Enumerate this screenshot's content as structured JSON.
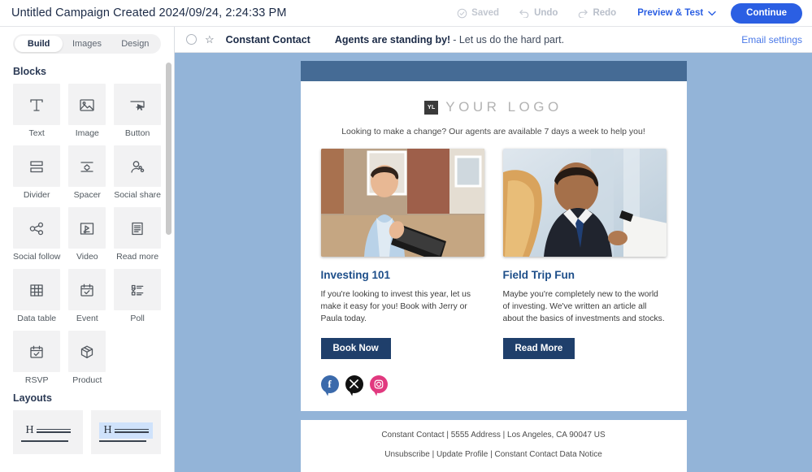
{
  "topbar": {
    "campaign_title": "Untitled Campaign Created 2024/09/24, 2:24:33 PM",
    "saved_label": "Saved",
    "undo_label": "Undo",
    "redo_label": "Redo",
    "preview_test_label": "Preview & Test",
    "continue_label": "Continue",
    "accent_color": "#2b5fe3"
  },
  "sidebar": {
    "tabs": [
      {
        "label": "Build",
        "active": true
      },
      {
        "label": "Images",
        "active": false
      },
      {
        "label": "Design",
        "active": false
      }
    ],
    "blocks_title": "Blocks",
    "blocks": [
      {
        "label": "Text",
        "icon": "text-icon"
      },
      {
        "label": "Image",
        "icon": "image-icon"
      },
      {
        "label": "Button",
        "icon": "button-icon"
      },
      {
        "label": "Divider",
        "icon": "divider-icon"
      },
      {
        "label": "Spacer",
        "icon": "spacer-icon"
      },
      {
        "label": "Social share",
        "icon": "social-share-icon"
      },
      {
        "label": "Social follow",
        "icon": "social-follow-icon"
      },
      {
        "label": "Video",
        "icon": "video-icon"
      },
      {
        "label": "Read more",
        "icon": "read-more-icon"
      },
      {
        "label": "Data table",
        "icon": "data-table-icon"
      },
      {
        "label": "Event",
        "icon": "event-icon"
      },
      {
        "label": "Poll",
        "icon": "poll-icon"
      },
      {
        "label": "RSVP",
        "icon": "rsvp-icon"
      },
      {
        "label": "Product",
        "icon": "product-icon"
      }
    ],
    "layouts_title": "Layouts",
    "layouts": [
      {
        "name": "layout-heading-text",
        "selected": false
      },
      {
        "name": "layout-heading-text-highlighted",
        "selected": true
      }
    ]
  },
  "subject_bar": {
    "brand": "Constant Contact",
    "subject_strong": "Agents are standing by!",
    "subject_rest": "- Let us do the hard part.",
    "email_settings_label": "Email settings"
  },
  "email": {
    "logo_mark": "YL",
    "logo_text": "YOUR  LOGO",
    "tagline": "Looking to make a change? Our agents are available 7 days a week to help you!",
    "header_color": "#456b95",
    "canvas_color": "#93b4d8",
    "columns": [
      {
        "title": "Investing 101",
        "body": "If you're looking to invest this year, let us make it easy for you! Book with Jerry or Paula today.",
        "cta": "Book Now",
        "image_alt": "smiling-man-with-binder-outside-house"
      },
      {
        "title": "Field Trip Fun",
        "body": "Maybe you're completely new to the world of investing. We've written an article all about the basics of investments and stocks.",
        "cta": "Read More",
        "image_alt": "man-in-suit-reviewing-document-with-woman"
      }
    ],
    "social": [
      {
        "name": "facebook",
        "glyph": "f",
        "color": "#3b6aab"
      },
      {
        "name": "x-twitter",
        "glyph": "✕",
        "color": "#111111"
      },
      {
        "name": "instagram",
        "glyph": "□",
        "color": "#e1397f"
      }
    ],
    "footer_address": "Constant Contact | 5555 Address | Los Angeles, CA 90047 US",
    "footer_links": "Unsubscribe | Update Profile | Constant Contact Data Notice"
  }
}
